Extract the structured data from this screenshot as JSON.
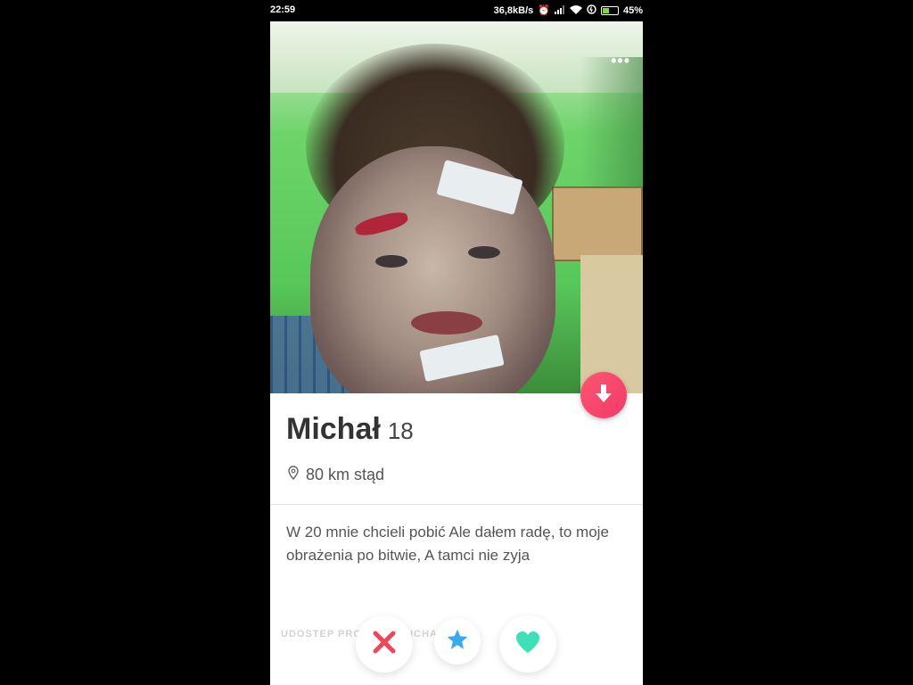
{
  "status_bar": {
    "time": "22:59",
    "network_speed": "36,8kB/s",
    "battery_percent": "45%",
    "battery_level": 0.45,
    "icons": [
      "alarm-icon",
      "signal-icon",
      "wifi-icon",
      "data-saver-icon",
      "battery-icon"
    ]
  },
  "profile": {
    "name": "Michał",
    "age": "18",
    "distance": "80 km stąd",
    "bio": "W 20 mnie chcieli pobić Ale dałem radę, to moje obrażenia po bitwie, A tamci nie zyja",
    "faded_footer_text": "UDOSTEP PROFIL TK MICHAL"
  },
  "icons": {
    "more": "more-dots-icon",
    "info": "arrow-down-icon",
    "location": "location-pin-icon",
    "nope": "close-x-icon",
    "super_like": "star-icon",
    "like": "heart-icon"
  },
  "colors": {
    "accent": "#fe4f6c",
    "nope": "#f0465a",
    "super_like": "#3ba9ea",
    "like": "#3fe0b5"
  }
}
